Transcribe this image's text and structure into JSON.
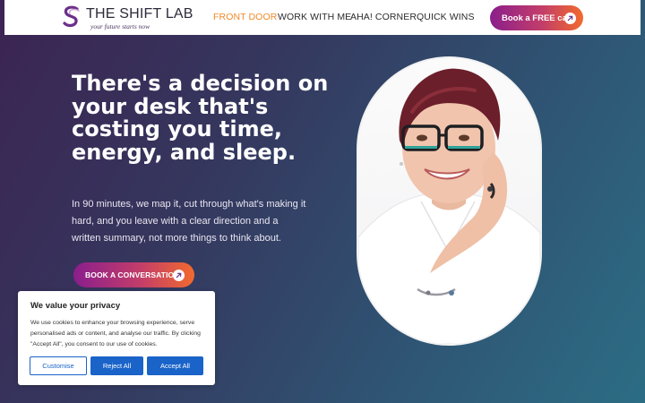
{
  "brand": {
    "name": "THE SHIFT LAB",
    "tagline": "your future starts now",
    "accent_orange": "#f08a2a",
    "gradient_purple": "#8a1e8c",
    "gradient_orange": "#f26a2e"
  },
  "nav": {
    "items": [
      {
        "label": "FRONT DOOR",
        "active": true
      },
      {
        "label": "WORK WITH ME",
        "active": false
      },
      {
        "label": "AHA! CORNER",
        "active": false
      },
      {
        "label": "QUICK WINS",
        "active": false
      }
    ],
    "cta_label": "Book a FREE call",
    "cta_icon": "arrow-up-right-icon"
  },
  "hero": {
    "headline": "There's a decision on your desk that's costing you time, energy, and sleep.",
    "subcopy": "In 90 minutes, we map it, cut through what's making it hard, and you leave with a clear direction and a written summary, not more things to think about.",
    "cta_label": "BOOK A CONVERSATION",
    "cta_icon": "arrow-up-right-icon",
    "portrait_alt": "portrait-photo"
  },
  "cookie": {
    "title": "We value your privacy",
    "text": "We use cookies to enhance your browsing experience, serve personalised ads or content, and analyse our traffic. By clicking \"Accept All\", you consent to our use of cookies.",
    "customise_label": "Customise",
    "reject_label": "Reject All",
    "accept_label": "Accept All",
    "button_color": "#1a63c9"
  }
}
